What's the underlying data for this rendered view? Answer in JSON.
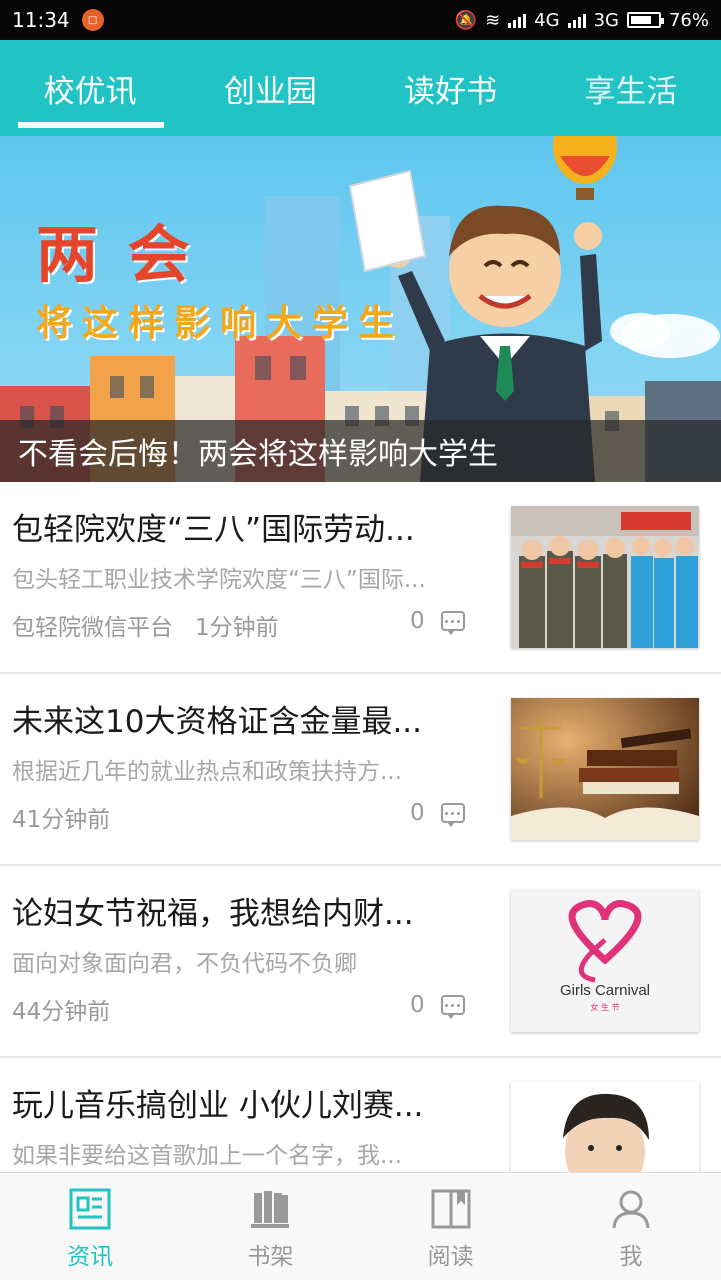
{
  "status_bar": {
    "time": "11:34",
    "network_1": "4G",
    "network_2": "3G",
    "battery": "76%",
    "battery_level": 0.76
  },
  "top_tabs": [
    {
      "label": "校优讯",
      "active": true
    },
    {
      "label": "创业园",
      "active": false
    },
    {
      "label": "读好书",
      "active": false
    },
    {
      "label": "享生活",
      "active": false
    }
  ],
  "banner": {
    "headline": "两 会",
    "subline": "将这样影响大学生",
    "caption": "不看会后悔！两会将这样影响大学生"
  },
  "news": [
    {
      "title": "包轻院欢度“三八”国际劳动...",
      "summary": "包头轻工职业技术学院欢度“三八”国际...",
      "source": "包轻院微信平台",
      "time": "1分钟前",
      "comments": "0"
    },
    {
      "title": "未来这10大资格证含金量最...",
      "summary": "根据近几年的就业热点和政策扶持方...",
      "source": "",
      "time": "41分钟前",
      "comments": "0"
    },
    {
      "title": "论妇女节祝福，我想给内财...",
      "summary": "面向对象面向君，不负代码不负卿",
      "source": "",
      "time": "44分钟前",
      "comments": "0"
    },
    {
      "title": "玩儿音乐搞创业 小伙儿刘赛...",
      "summary": "如果非要给这首歌加上一个名字，我...",
      "source": "",
      "time": "",
      "comments": ""
    }
  ],
  "thumb3": {
    "brand": "Girls Carnival",
    "sub": "女 生 节"
  },
  "bottom_nav": [
    {
      "label": "资讯",
      "icon": "news-icon",
      "active": true
    },
    {
      "label": "书架",
      "icon": "bookshelf-icon",
      "active": false
    },
    {
      "label": "阅读",
      "icon": "book-open-icon",
      "active": false
    },
    {
      "label": "我",
      "icon": "person-icon",
      "active": false
    }
  ],
  "colors": {
    "accent": "#21c3c4",
    "status_bar": "#060606",
    "banner_text": "#e5452a",
    "banner_subtext": "#f3a71c"
  }
}
